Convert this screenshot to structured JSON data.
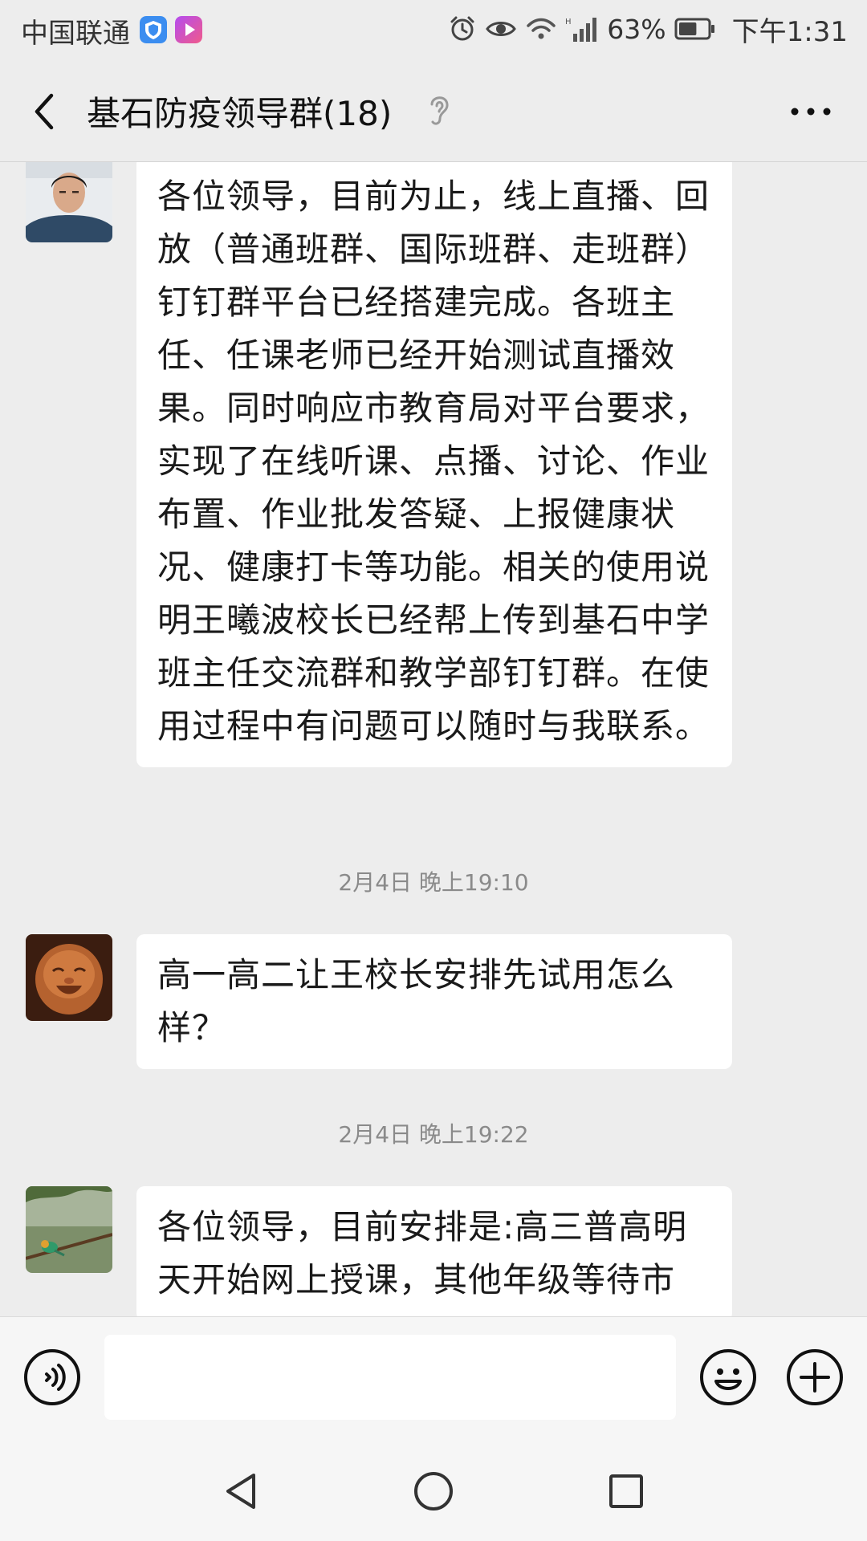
{
  "status_bar": {
    "carrier": "中国联通",
    "battery_percent": "63%",
    "time": "下午1:31",
    "icons": [
      "shield-app-icon",
      "video-app-icon",
      "alarm-icon",
      "eye-icon",
      "wifi-icon",
      "signal-icon",
      "battery-icon"
    ],
    "battery_level": 0.63
  },
  "header": {
    "title": "基石防疫领导群(18)",
    "icons": [
      "back-icon",
      "ear-icon",
      "more-icon"
    ]
  },
  "messages": [
    {
      "type": "message",
      "avatar": "man-photo-avatar",
      "text": "各位领导，目前为止，线上直播、回放（普通班群、国际班群、走班群）钉钉群平台已经搭建完成。各班主任、任课老师已经开始测试直播效果。同时响应市教育局对平台要求，实现了在线听课、点播、讨论、作业布置、作业批发答疑、上报健康状况、健康打卡等功能。相关的使用说明王曦波校长已经帮上传到基石中学班主任交流群和教学部钉钉群。在使用过程中有问题可以随时与我联系。"
    },
    {
      "type": "time",
      "text": "2月4日 晚上19:10"
    },
    {
      "type": "message",
      "avatar": "buddha-statue-avatar",
      "text": "高一高二让王校长安排先试用怎么样？"
    },
    {
      "type": "time",
      "text": "2月4日 晚上19:22"
    },
    {
      "type": "message",
      "avatar": "bird-photo-avatar",
      "text": "各位领导，目前安排是:高三普高明天开始网上授课，其他年级等待市"
    }
  ],
  "input_bar": {
    "value": "",
    "placeholder": "",
    "icons": [
      "voice-icon",
      "emoji-icon",
      "plus-icon"
    ]
  },
  "nav_bar": {
    "icons": [
      "back-triangle-icon",
      "home-circle-icon",
      "recents-square-icon"
    ]
  },
  "colors": {
    "background": "#ededed",
    "bubble": "#ffffff",
    "timestamp": "#8a8a8a"
  }
}
